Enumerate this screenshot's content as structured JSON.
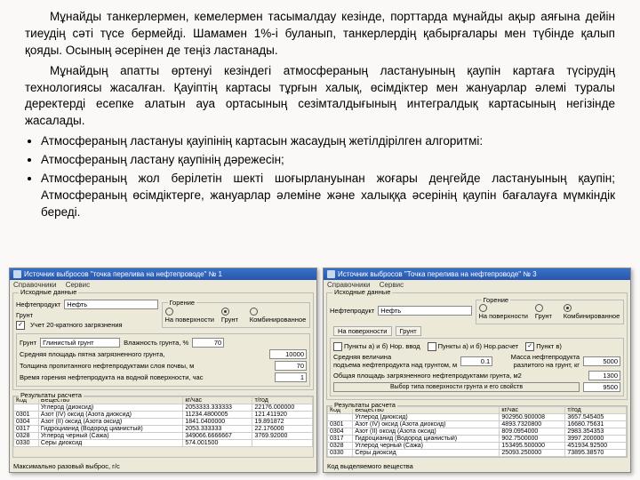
{
  "paragraphs": [
    "Мұнайды танкерлермен, кемелермен тасымалдау кезінде, порттарда мұнайды ақыр аяғына дейін тиеудің сәті түсе бермейді. Шамамен 1%-і буланып, танкерлердің қабырғалары мен түбінде қалып қояды. Осының әсерінен де теңіз ластанады.",
    "Мұнайдың апатты өртенуі кезіндегі атмосфераның ластануының қаупін картаға түсірудің технологиясы жасалған. Қауіптің картасы тұрғын халық, өсімдіктер мен жануарлар әлемі туралы деректерді есепке алатын ауа ортасының сезімталдығының интегралдық картасының негізінде жасалады."
  ],
  "bullets": [
    "Атмосфераның ластануы қауіпінің картасын жасаудың жетілдірілген алгоритмі:",
    "Атмосфераның ластану қаупінің дәрежесін;",
    "Атмосфераның жол берілетін шекті шоғырлануынан жоғары деңгейде ластануының қаупін; Атмосфераның өсімдіктерге, жануарлар әлеміне және халыққа әсерінің қаупін бағалауға мүмкіндік береді."
  ],
  "win1": {
    "title": "Источник выбросов \"точка перелива на нефтепроводе\" № 1",
    "menu": [
      "Справочники",
      "Сервис"
    ],
    "panel_input": "Исходные данные",
    "lbl_product": "Нефтепродукт",
    "product": "Нефть",
    "lbl_soil": "Грунт",
    "chk_soil": "Учет 20-кратного загрязнения",
    "panel_burn": "Горение",
    "burn_opts": [
      "На поверхности",
      "Грунт",
      "Комбинированное"
    ],
    "soil_val": "Глинистый грунт",
    "lbl_hum": "Влажность грунта, %",
    "hum": "70",
    "lbl_area": "Средняя площадь пятна загрязненного грунта,",
    "area": "10000",
    "lbl_layer": "Толщина пропитанного нефтепродуктами слоя почвы, м",
    "layer": "70",
    "lbl_time": "Время горения нефтепродукта на водной поверхности, час",
    "time": "1",
    "panel_results": "Результаты расчета",
    "cols": [
      "Код",
      "Вещество",
      "кг/час",
      "т/год"
    ],
    "rows": [
      [
        "",
        "Углерод (диоксид)",
        "2053333.333333",
        "22176.000000"
      ],
      [
        "0301",
        "Азот (IV) оксид (Азота диоксид)",
        "11234.4800005",
        "121.411920"
      ],
      [
        "0304",
        "Азот (II) оксид (Азота оксид)",
        "1841.0400000",
        "19.891872"
      ],
      [
        "0317",
        "Гидроцианид (Водород цианистый)",
        "2053.333333",
        "22.176000"
      ],
      [
        "0328",
        "Углерод черный (Сажа)",
        "349066.6666667",
        "3769.92000"
      ],
      [
        "0330",
        "Серы диоксид",
        "574.001500",
        ""
      ]
    ],
    "bot": "Максимально разовый выброс, г/с"
  },
  "win2": {
    "title": "Источник выбросов \"Точка перелива на нефтепроводе\" № 3",
    "menu": [
      "Справочники",
      "Сервис"
    ],
    "panel_input": "Исходные данные",
    "lbl_product": "Нефтепродукт",
    "product": "Нефть",
    "panel_burn": "Горение",
    "burn_opts": [
      "На поверхности",
      "Грунт",
      "Комбинированное"
    ],
    "tabs": [
      "На поверхности",
      "Грунт"
    ],
    "chk_a": "Пункты a) и б) Нор. ввод",
    "chk_b": "Пункты a) и б) Нор.расчет",
    "chk_c": "Пункт в)",
    "lbl_wave": "Средняя величина",
    "lbl_wave2": "подъема нефтепродукта над грунтом, м",
    "wave": "0.1",
    "lbl_mass": "Масса нефтепродукта",
    "lbl_mass2": "разлитого на грунт, кг",
    "mass": "5000",
    "lbl_area": "Общая площадь загрязненного нефтепродуктами грунта, м2",
    "area": "1300",
    "btn_label": "Выбор типа поверхности грунта и его свойств",
    "btn_val": "9500",
    "panel_results": "Результаты расчета",
    "cols": [
      "Код",
      "Вещество",
      "кг/час",
      "т/год"
    ],
    "rows": [
      [
        "",
        "Углерод (диоксид)",
        "902950.900008",
        "3657.545405"
      ],
      [
        "0301",
        "Азот (IV) оксид (Азота диоксид)",
        "4893.7320800",
        "16680.75631"
      ],
      [
        "0304",
        "Азот (II) оксид (Азота оксид)",
        "809.0954000",
        "2983.354353"
      ],
      [
        "0317",
        "Гидроцианид (Водород цианистый)",
        "902.7500000",
        "3997.200000"
      ],
      [
        "0328",
        "Углерод черный (Сажа)",
        "153495.500000",
        "451934.92500"
      ],
      [
        "0330",
        "Серы диоксид",
        "25093.250000",
        "73895.38570"
      ]
    ],
    "bot": "Код выделяемого вещества"
  }
}
